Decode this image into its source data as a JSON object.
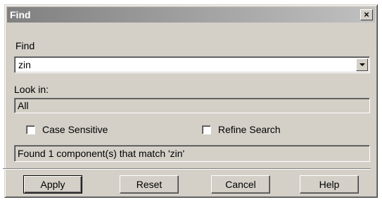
{
  "window": {
    "title": "Find",
    "close_glyph": "×"
  },
  "find": {
    "label": "Find",
    "value": "zin"
  },
  "look_in": {
    "label": "Look in:",
    "value": "All"
  },
  "options": {
    "case_sensitive": "Case Sensitive",
    "refine_search": "Refine Search"
  },
  "status": {
    "text": "Found 1 component(s) that match 'zin'"
  },
  "buttons": {
    "apply": "Apply",
    "reset": "Reset",
    "cancel": "Cancel",
    "help": "Help"
  },
  "icons": {
    "close": "close-icon",
    "dropdown": "chevron-down-icon"
  }
}
